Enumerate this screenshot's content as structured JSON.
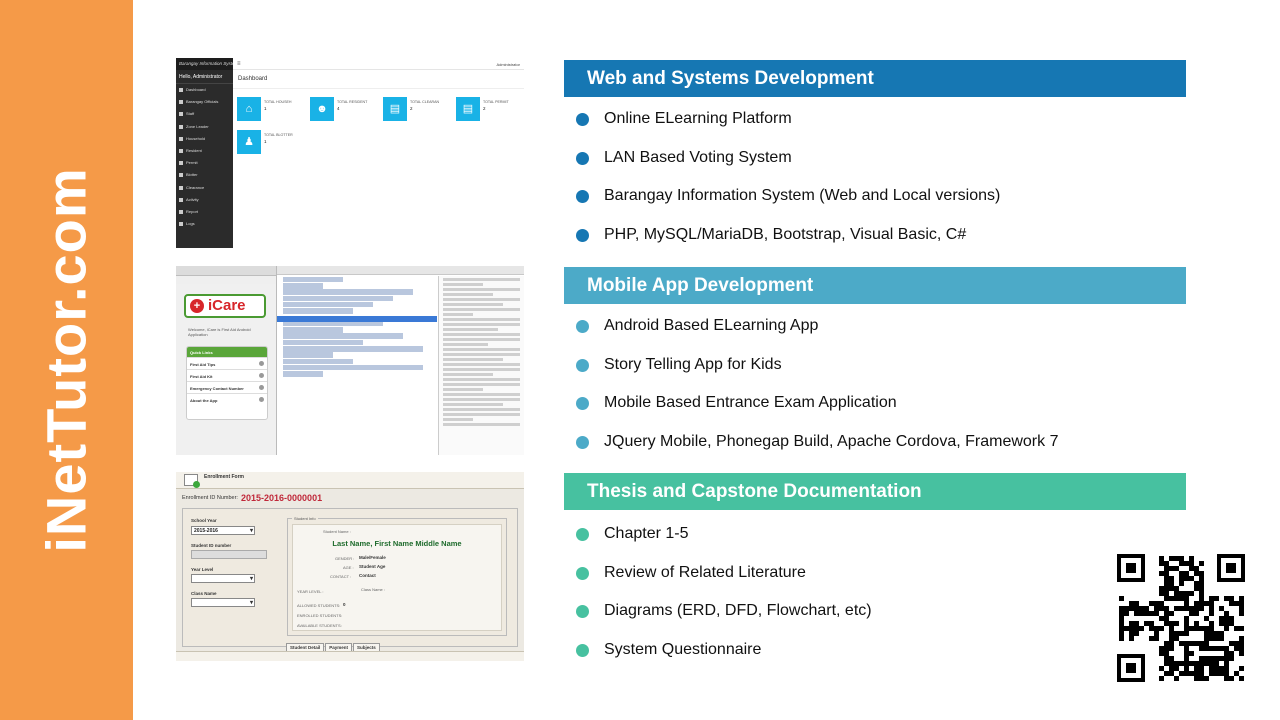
{
  "brand": {
    "side_text": "iNetTutor.com",
    "color": "#f59a48"
  },
  "shots": {
    "dashboard": {
      "brand": "Barangay Information System",
      "greeting": "Hello, Administrator",
      "user": "Administrator",
      "title": "Dashboard",
      "menu": [
        "Dashboard",
        "Barangay Officials",
        "Staff",
        "Zone Leader",
        "Household",
        "Resident",
        "Permit",
        "Blotter",
        "Clearance",
        "Activity",
        "Report",
        "Logs"
      ],
      "tiles": [
        {
          "label": "TOTAL HOUSEH",
          "value": "1"
        },
        {
          "label": "TOTAL RESIDENT",
          "value": "4"
        },
        {
          "label": "TOTAL CLEARAN",
          "value": "2"
        },
        {
          "label": "TOTAL PERMIT",
          "value": "2"
        },
        {
          "label": "TOTAL BLOTTER",
          "value": "1"
        }
      ]
    },
    "mobile": {
      "logo": "iCare",
      "welcome": "Welcome, iCare is First Aid Android Application",
      "panel_title": "Quick Links",
      "items": [
        "First Aid Tips",
        "First Aid Kit",
        "Emergency Contact Number",
        "About the App"
      ]
    },
    "enrollment": {
      "title": "Enrollment Form",
      "id_label": "Enrollment ID Number:",
      "id_value": "2015-2016-0000001",
      "school_year_label": "School Year",
      "school_year_value": "2015-2016",
      "student_id_label": "Student ID number",
      "year_level_label": "Year Level",
      "class_name_label": "Class Name",
      "info_title": "Student Info",
      "student_name_label": "Student Name :",
      "student_name": "Last Name, First Name Middle Name",
      "gender_label": "GENDER :",
      "gender_value": "Male/Female",
      "age_label": "AGE :",
      "age_value": "Student Age",
      "contact_label": "CONTACT :",
      "contact_value": "Contact",
      "year_level_small": "YEAR LEVEL :",
      "class_name_small": "Class Name :",
      "allowed": "ALLOWED STUDENTS:",
      "allowed_value": "0",
      "enrolled": "ENROLLED STUDENTS:",
      "available": "AVAILABLE STUDENTS:",
      "tabs": [
        "Student Detail",
        "Payment",
        "Subjects"
      ]
    }
  },
  "sections": [
    {
      "title": "Web and Systems Development",
      "color": "#1677b3",
      "items": [
        "Online ELearning Platform",
        "LAN Based Voting System",
        "Barangay Information  System (Web and  Local versions)",
        "PHP, MySQL/MariaDB, Bootstrap, Visual Basic, C#"
      ]
    },
    {
      "title": "Mobile App Development",
      "color": "#4caac8",
      "items": [
        "Android Based ELearning App",
        "Story Telling App for Kids",
        "Mobile Based Entrance Exam Application",
        "JQuery Mobile, Phonegap Build, Apache Cordova, Framework 7"
      ]
    },
    {
      "title": "Thesis and Capstone Documentation",
      "color": "#47c1a0",
      "items": [
        "Chapter 1-5",
        "Review of Related Literature",
        "Diagrams (ERD, DFD, Flowchart,  etc)",
        "System Questionnaire"
      ]
    }
  ],
  "qr": {
    "icon": "qr-code-icon"
  }
}
